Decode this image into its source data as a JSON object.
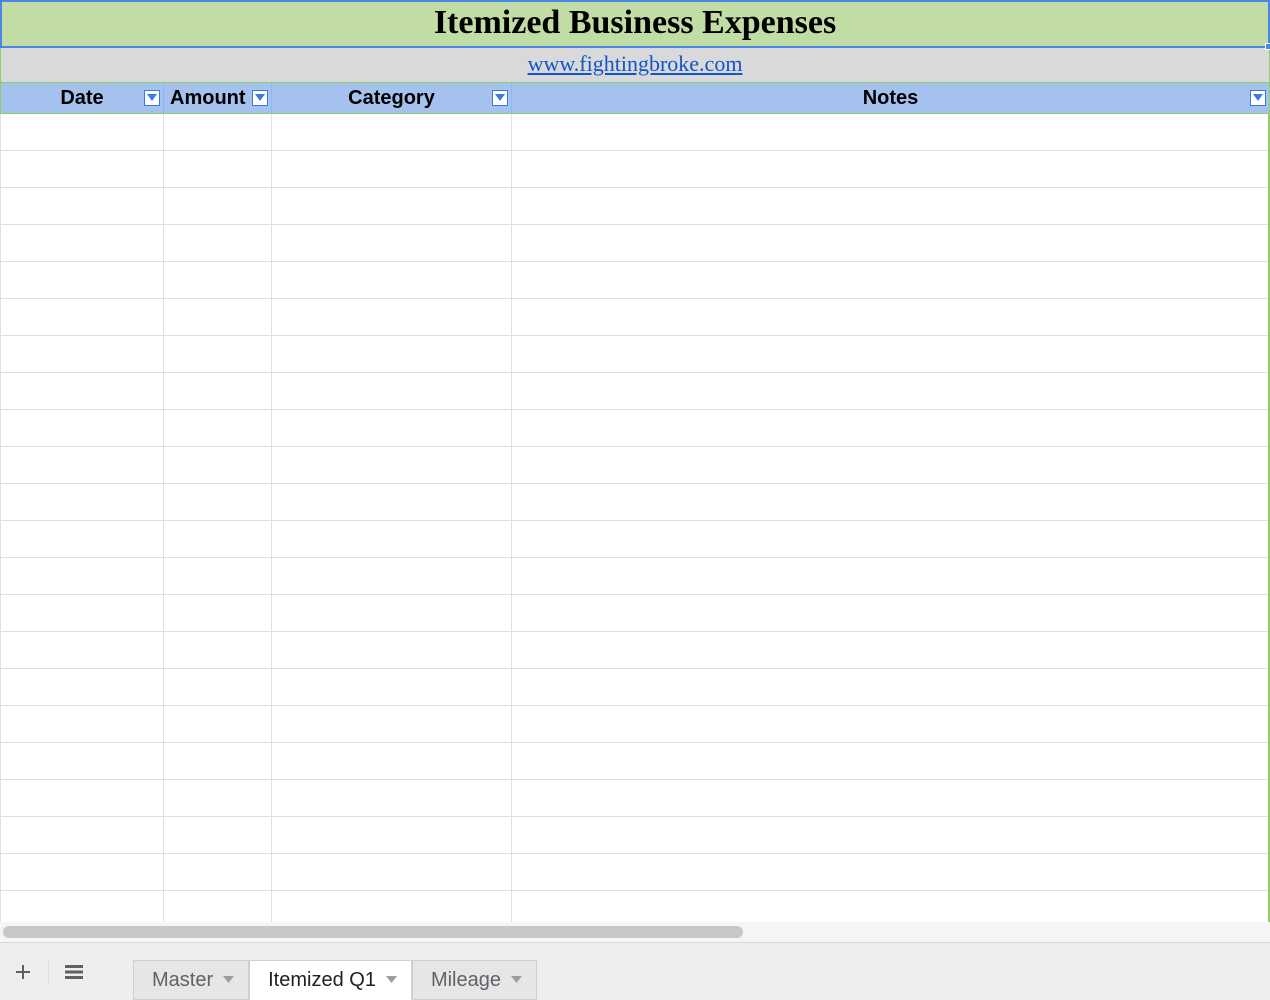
{
  "title": "Itemized Business Expenses",
  "site_link": "www.fightingbroke.com",
  "columns": {
    "date": "Date",
    "amount": "Amount",
    "category": "Category",
    "notes": "Notes"
  },
  "rows": [
    "",
    "",
    "",
    "",
    "",
    "",
    "",
    "",
    "",
    "",
    "",
    "",
    "",
    "",
    "",
    "",
    "",
    "",
    "",
    "",
    "",
    ""
  ],
  "sheet_tabs": [
    {
      "label": "Master",
      "active": false
    },
    {
      "label": "Itemized Q1",
      "active": true
    },
    {
      "label": "Mileage",
      "active": false
    }
  ],
  "colors": {
    "title_bg": "#c2dca5",
    "selection_border": "#4a86e8",
    "header_bg": "#a4c2ed",
    "green_border": "#8fce64",
    "link": "#1155cc"
  }
}
